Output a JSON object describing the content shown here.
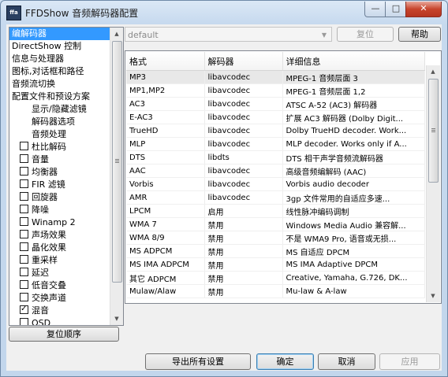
{
  "window": {
    "title": "FFDShow 音频解码器配置",
    "icon_text": "ffa",
    "min": "—",
    "max": "□",
    "close": "✕"
  },
  "tree": {
    "items": [
      {
        "label": "编解码器",
        "type": "plain",
        "selected": true
      },
      {
        "label": "DirectShow 控制",
        "type": "plain"
      },
      {
        "label": "信息与处理器",
        "type": "plain"
      },
      {
        "label": "图标,对话框和路径",
        "type": "plain"
      },
      {
        "label": "音频流切换",
        "type": "plain"
      },
      {
        "label": "配置文件和预设方案",
        "type": "plain"
      },
      {
        "label": "显示/隐藏滤镜",
        "type": "sub"
      },
      {
        "label": "解码器选项",
        "type": "sub"
      },
      {
        "label": "音频处理",
        "type": "sub"
      },
      {
        "label": "杜比解码",
        "type": "check",
        "checked": false
      },
      {
        "label": "音量",
        "type": "check",
        "checked": false
      },
      {
        "label": "均衡器",
        "type": "check",
        "checked": false
      },
      {
        "label": "FIR 滤镜",
        "type": "check",
        "checked": false
      },
      {
        "label": "回旋器",
        "type": "check",
        "checked": false
      },
      {
        "label": "降噪",
        "type": "check",
        "checked": false
      },
      {
        "label": "Winamp 2",
        "type": "check",
        "checked": false
      },
      {
        "label": "声场效果",
        "type": "check",
        "checked": false
      },
      {
        "label": "晶化效果",
        "type": "check",
        "checked": false
      },
      {
        "label": "重采样",
        "type": "check",
        "checked": false
      },
      {
        "label": "延迟",
        "type": "check",
        "checked": false
      },
      {
        "label": "低音交叠",
        "type": "check",
        "checked": false
      },
      {
        "label": "交换声道",
        "type": "check",
        "checked": false
      },
      {
        "label": "混音",
        "type": "check",
        "checked": true
      },
      {
        "label": "OSD",
        "type": "check",
        "checked": false
      }
    ],
    "reset_order_label": "复位顺序"
  },
  "preset": {
    "value": "default",
    "reset_label": "复位",
    "help_label": "帮助"
  },
  "codecs": {
    "columns": [
      "格式",
      "解码器",
      "详细信息"
    ],
    "rows": [
      [
        "MP3",
        "libavcodec",
        "MPEG-1 音频层面 3"
      ],
      [
        "MP1,MP2",
        "libavcodec",
        "MPEG-1 音频层面 1,2"
      ],
      [
        "AC3",
        "libavcodec",
        "ATSC A-52 (AC3) 解码器"
      ],
      [
        "E-AC3",
        "libavcodec",
        "扩展 AC3 解码器 (Dolby Digit..."
      ],
      [
        "TrueHD",
        "libavcodec",
        "Dolby TrueHD decoder. Work..."
      ],
      [
        "MLP",
        "libavcodec",
        "MLP decoder. Works only if A..."
      ],
      [
        "DTS",
        "libdts",
        "DTS 相干声学音频流解码器"
      ],
      [
        "AAC",
        "libavcodec",
        "高级音频编解码 (AAC)"
      ],
      [
        "Vorbis",
        "libavcodec",
        "Vorbis audio decoder"
      ],
      [
        "AMR",
        "libavcodec",
        "3gp 文件常用的自适应多速..."
      ],
      [
        "LPCM",
        "启用",
        "线性脉冲编码调制"
      ],
      [
        "WMA 7",
        "禁用",
        "Windows Media Audio 兼容解..."
      ],
      [
        "WMA 8/9",
        "禁用",
        "不是 WMA9 Pro, 语音或无损..."
      ],
      [
        "MS ADPCM",
        "禁用",
        "MS 自适应 DPCM"
      ],
      [
        "MS IMA ADPCM",
        "禁用",
        "MS IMA Adaptive DPCM"
      ],
      [
        "其它 ADPCM",
        "禁用",
        "Creative, Yamaha, G.726, DK..."
      ],
      [
        "Mulaw/Alaw",
        "禁用",
        "Mu-law & A-law"
      ]
    ]
  },
  "footer": {
    "export_label": "导出所有设置",
    "ok_label": "确定",
    "cancel_label": "取消",
    "apply_label": "应用"
  },
  "scroll": {
    "up": "▲",
    "down": "▼"
  }
}
